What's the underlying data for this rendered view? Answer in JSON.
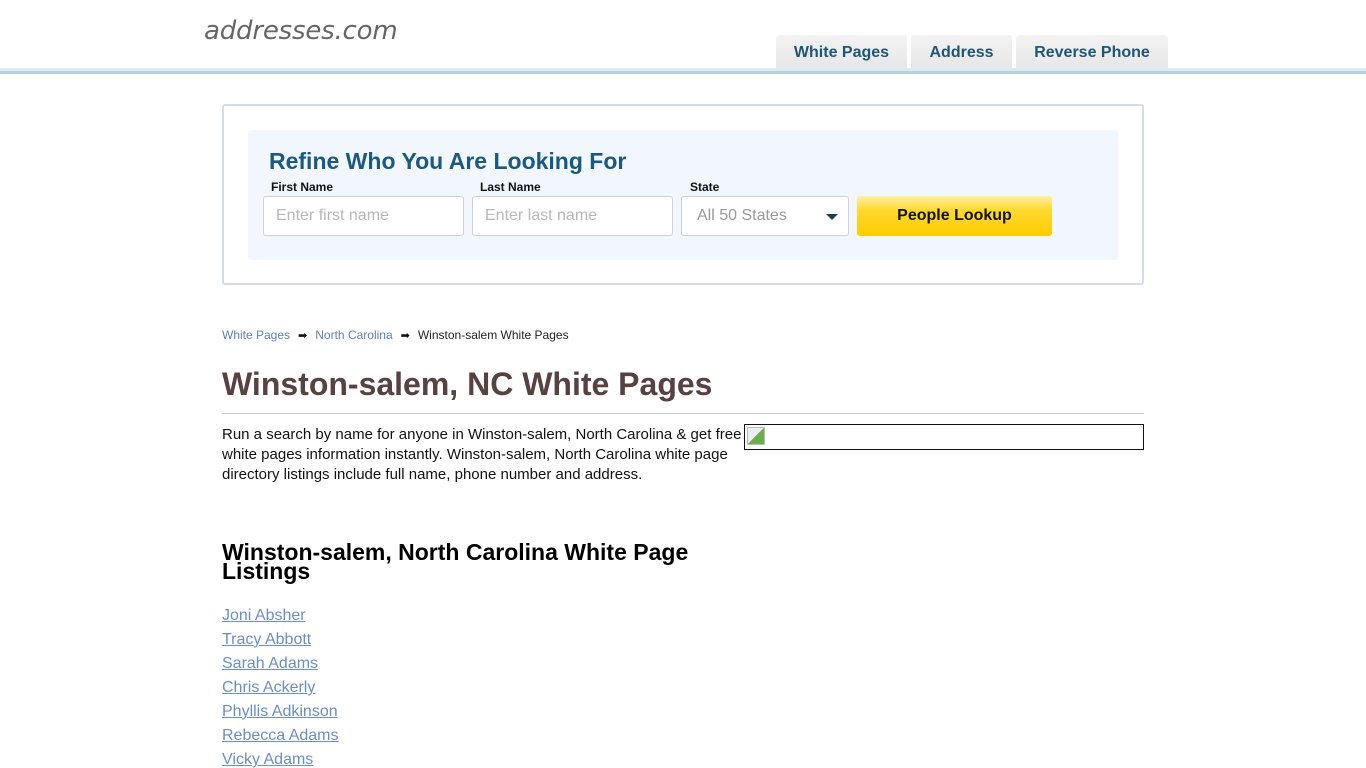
{
  "header": {
    "logo": "addresses.com",
    "nav": [
      {
        "label": "White Pages"
      },
      {
        "label": "Address"
      },
      {
        "label": "Reverse Phone"
      }
    ]
  },
  "search": {
    "title": "Refine Who You Are Looking For",
    "first_name_label": "First Name",
    "first_name_placeholder": "Enter first name",
    "first_name_value": "",
    "last_name_label": "Last Name",
    "last_name_placeholder": "Enter last name",
    "last_name_value": "",
    "state_label": "State",
    "state_selected": "All 50 States",
    "button_label": "People Lookup"
  },
  "breadcrumb": {
    "items": [
      {
        "label": "White Pages"
      },
      {
        "label": "North Carolina"
      }
    ],
    "separator_icon": "arrow-right-icon",
    "current": "Winston-salem White Pages"
  },
  "page": {
    "title": "Winston-salem, NC White Pages",
    "intro": "Run a search by name for anyone in Winston-salem, North Carolina & get free white pages information instantly. Winston-salem, North Carolina white page directory listings include full name, phone number and address.",
    "listings_title": "Winston-salem, North Carolina White Page Listings",
    "listings": [
      {
        "name": "Joni Absher"
      },
      {
        "name": "Tracy Abbott"
      },
      {
        "name": "Sarah Adams"
      },
      {
        "name": "Chris Ackerly"
      },
      {
        "name": "Phyllis Adkinson"
      },
      {
        "name": "Rebecca Adams"
      },
      {
        "name": "Vicky Adams"
      }
    ]
  },
  "colors": {
    "brand_blue": "#1a5a82",
    "link": "#6b8ec8",
    "title_brown": "#574141",
    "button_yellow": "#ffcc00"
  }
}
